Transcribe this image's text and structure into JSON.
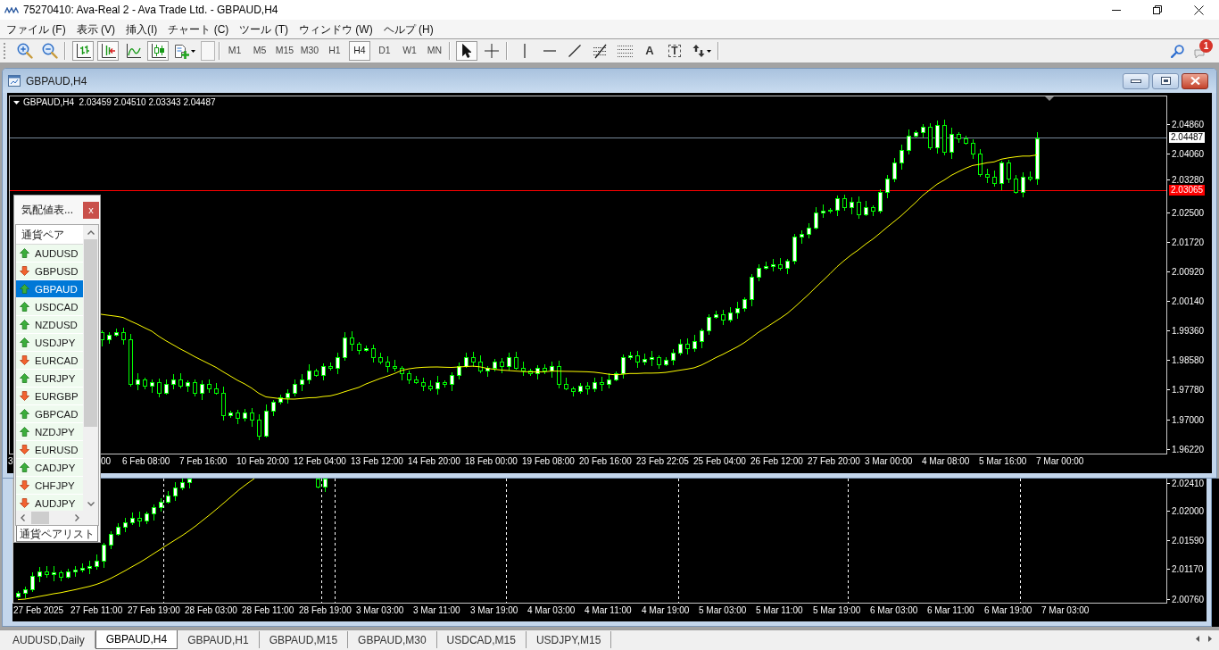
{
  "window": {
    "title": "75270410: Ava-Real 2 - Ava Trade Ltd. - GBPAUD,H4"
  },
  "menu": [
    "ファイル (F)",
    "表示 (V)",
    "挿入(I)",
    "チャート (C)",
    "ツール (T)",
    "ウィンドウ (W)",
    "ヘルプ (H)"
  ],
  "toolbar": {
    "zoom_tools": [
      {
        "kind": "zoom-in",
        "pressed": false
      },
      {
        "kind": "zoom-out",
        "pressed": false
      }
    ],
    "chart_tools": [
      {
        "kind": "bars",
        "pressed": true
      },
      {
        "kind": "shift",
        "pressed": true
      },
      {
        "kind": "line",
        "pressed": false
      },
      {
        "kind": "candles",
        "pressed": true
      },
      {
        "kind": "template",
        "pressed": false
      }
    ],
    "timeframes": [
      {
        "label": "M1",
        "selected": false
      },
      {
        "label": "M5",
        "selected": false
      },
      {
        "label": "M15",
        "selected": false
      },
      {
        "label": "M30",
        "selected": false
      },
      {
        "label": "H1",
        "selected": false
      },
      {
        "label": "H4",
        "selected": true
      },
      {
        "label": "D1",
        "selected": false
      },
      {
        "label": "W1",
        "selected": false
      },
      {
        "label": "MN",
        "selected": false
      }
    ],
    "cursor_tools": [
      {
        "kind": "cursor",
        "selected": true
      },
      {
        "kind": "crosshair",
        "selected": false
      }
    ],
    "drawing_tools": [
      {
        "kind": "vline"
      },
      {
        "kind": "hline"
      },
      {
        "kind": "trendline"
      },
      {
        "kind": "fibo"
      },
      {
        "kind": "channel"
      },
      {
        "kind": "text",
        "label": "A"
      },
      {
        "kind": "label",
        "label": "T"
      },
      {
        "kind": "arrows"
      }
    ],
    "notification_count": "1"
  },
  "chart_window": {
    "title": "GBPAUD,H4",
    "info": "GBPAUD,H4  2.03459 2.04510 2.03343 2.04487",
    "price_ticks": [
      "2.04860",
      "2.04060",
      "2.03280",
      "2.02500",
      "2.01720",
      "2.00920",
      "2.00140",
      "1.99360",
      "1.98580",
      "1.97780",
      "1.97000",
      "1.96220"
    ],
    "bid_price": "2.04487",
    "level_price": "2.03065",
    "time_fragments": [
      "3",
      "00"
    ],
    "time_labels": [
      "6 Feb 08:00",
      "7 Feb 16:00",
      "10 Feb 20:00",
      "12 Feb 04:00",
      "13 Feb 12:00",
      "14 Feb 20:00",
      "18 Feb 00:00",
      "19 Feb 08:00",
      "20 Feb 16:00",
      "23 Feb 22:05",
      "25 Feb 04:00",
      "26 Feb 12:00",
      "27 Feb 20:00",
      "3 Mar 00:00",
      "4 Mar 08:00",
      "5 Mar 16:00",
      "7 Mar 00:00"
    ]
  },
  "background_chart": {
    "price_ticks": [
      "2.02410",
      "2.02000",
      "2.01590",
      "2.01170",
      "2.00760"
    ],
    "time_labels": [
      "27 Feb 2025",
      "27 Feb 11:00",
      "27 Feb 19:00",
      "28 Feb 03:00",
      "28 Feb 11:00",
      "28 Feb 19:00",
      "3 Mar 03:00",
      "3 Mar 11:00",
      "3 Mar 19:00",
      "4 Mar 03:00",
      "4 Mar 11:00",
      "4 Mar 19:00",
      "5 Mar 03:00",
      "5 Mar 11:00",
      "5 Mar 19:00",
      "6 Mar 03:00",
      "6 Mar 11:00",
      "6 Mar 19:00",
      "7 Mar 03:00"
    ]
  },
  "market_watch": {
    "title": "気配値表...",
    "close": "x",
    "column": "通貨ペア",
    "symbols": [
      {
        "name": "AUDUSD",
        "kind": "up",
        "selected": false
      },
      {
        "name": "GBPUSD",
        "kind": "down",
        "selected": false
      },
      {
        "name": "GBPAUD",
        "kind": "up",
        "selected": true
      },
      {
        "name": "USDCAD",
        "kind": "up",
        "selected": false
      },
      {
        "name": "NZDUSD",
        "kind": "up",
        "selected": false
      },
      {
        "name": "USDJPY",
        "kind": "up",
        "selected": false
      },
      {
        "name": "EURCAD",
        "kind": "down",
        "selected": false
      },
      {
        "name": "EURJPY",
        "kind": "up",
        "selected": false
      },
      {
        "name": "EURGBP",
        "kind": "down",
        "selected": false
      },
      {
        "name": "GBPCAD",
        "kind": "up",
        "selected": false
      },
      {
        "name": "NZDJPY",
        "kind": "up",
        "selected": false
      },
      {
        "name": "EURUSD",
        "kind": "down",
        "selected": false
      },
      {
        "name": "CADJPY",
        "kind": "up",
        "selected": false
      },
      {
        "name": "CHFJPY",
        "kind": "down",
        "selected": false
      },
      {
        "name": "AUDJPY",
        "kind": "down",
        "selected": false
      }
    ],
    "tab": "通貨ペアリスト"
  },
  "chart_tabs": [
    {
      "label": "AUDUSD,Daily",
      "selected": false
    },
    {
      "label": "GBPAUD,H4",
      "selected": true
    },
    {
      "label": "GBPAUD,H1",
      "selected": false
    },
    {
      "label": "GBPAUD,M15",
      "selected": false
    },
    {
      "label": "GBPAUD,M30",
      "selected": false
    },
    {
      "label": "USDCAD,M15",
      "selected": false
    },
    {
      "label": "USDJPY,M15",
      "selected": false
    }
  ]
}
